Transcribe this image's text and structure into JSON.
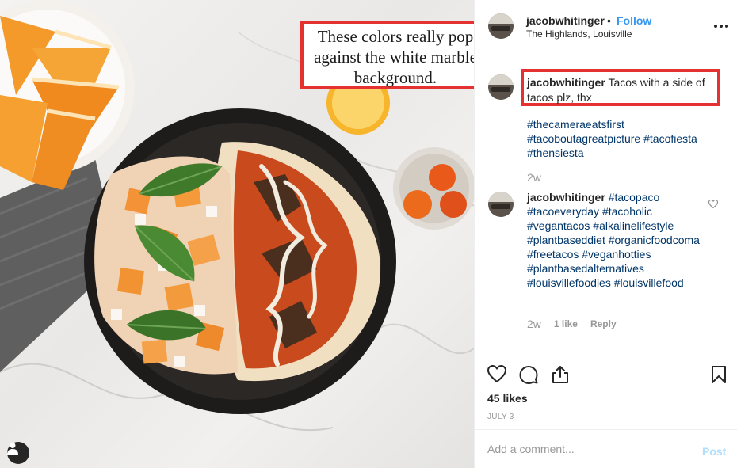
{
  "post": {
    "annotation": "These colors really pop against the white marble background.",
    "user_tag_icon": "person-icon"
  },
  "header": {
    "username": "jacobwhitinger",
    "separator": "•",
    "follow_label": "Follow",
    "location": "The Highlands, Louisville",
    "more_icon": "ellipsis-icon"
  },
  "caption": {
    "username": "jacobwhitinger",
    "text": "Tacos with a side of tacos plz, thx",
    "hashtags": "#thecameraeatsfirst #tacoboutagreatpicture #tacofiesta #thensiesta",
    "age": "2w"
  },
  "comment": {
    "username": "jacobwhitinger",
    "hashtags": "#tacopaco #tacoeveryday #tacoholic #vegantacos #alkalinelifestyle #plantbaseddiet #organicfoodcoma #freetacos #veganhotties #plantbasedalternatives #louisvillefoodies #louisvillefood",
    "age": "2w",
    "likes": "1 like",
    "reply_label": "Reply"
  },
  "actions": {
    "likes": "45 likes",
    "date": "JULY 3"
  },
  "add_comment": {
    "placeholder": "Add a comment...",
    "post_label": "Post"
  },
  "colors": {
    "annotation_border": "#e3322f",
    "follow": "#3897f0",
    "hashtag": "#003569",
    "post_disabled": "#b2dffc"
  }
}
